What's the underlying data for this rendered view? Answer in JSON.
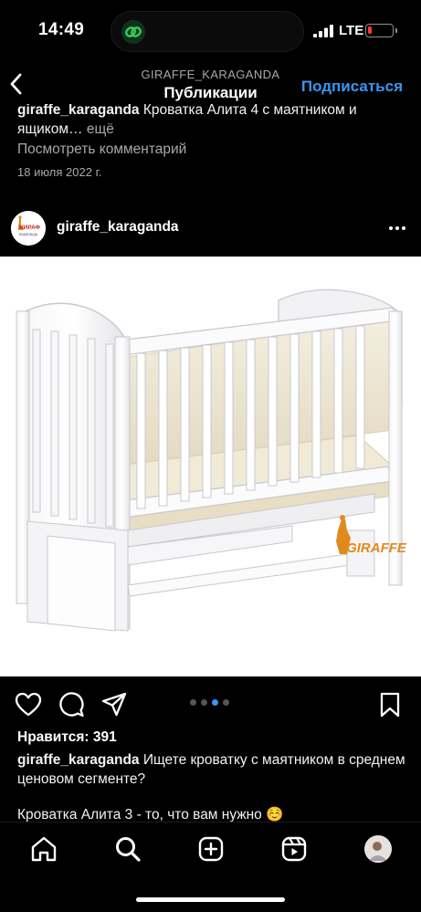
{
  "status_bar": {
    "time": "14:49",
    "network": "LTE",
    "battery_level": 0.18
  },
  "header": {
    "username": "GIRAFFE_KARAGANDA",
    "title": "Публикации",
    "follow_label": "Подписаться"
  },
  "previous_post": {
    "username": "giraffe_karaganda",
    "caption": "Кроватка Алита 4 с маятником и ящиком…",
    "more": " ещё",
    "view_comments": "Посмотреть комментарий",
    "date": "18 июля 2022 г."
  },
  "post": {
    "username": "giraffe_karaganda",
    "avatar_text": "ЖИРАФ",
    "avatar_city": "Караганда",
    "watermark_brand": "GIRAFFE",
    "likes": "Нравится: 391",
    "caption_username": "giraffe_karaganda",
    "caption_text": " Ищете кроватку с маятником в среднем ценовом сегменте?",
    "caption_line2": "Кроватка Алита 3 - то, что вам нужно ☺️",
    "carousel": {
      "count": 4,
      "active": 2
    }
  },
  "tabs": [
    "home",
    "search",
    "create",
    "reels",
    "profile"
  ],
  "colors": {
    "accent": "#3897f0",
    "background": "#000000",
    "battery": "#ff3b30",
    "carousel_active": "#3897f0"
  }
}
